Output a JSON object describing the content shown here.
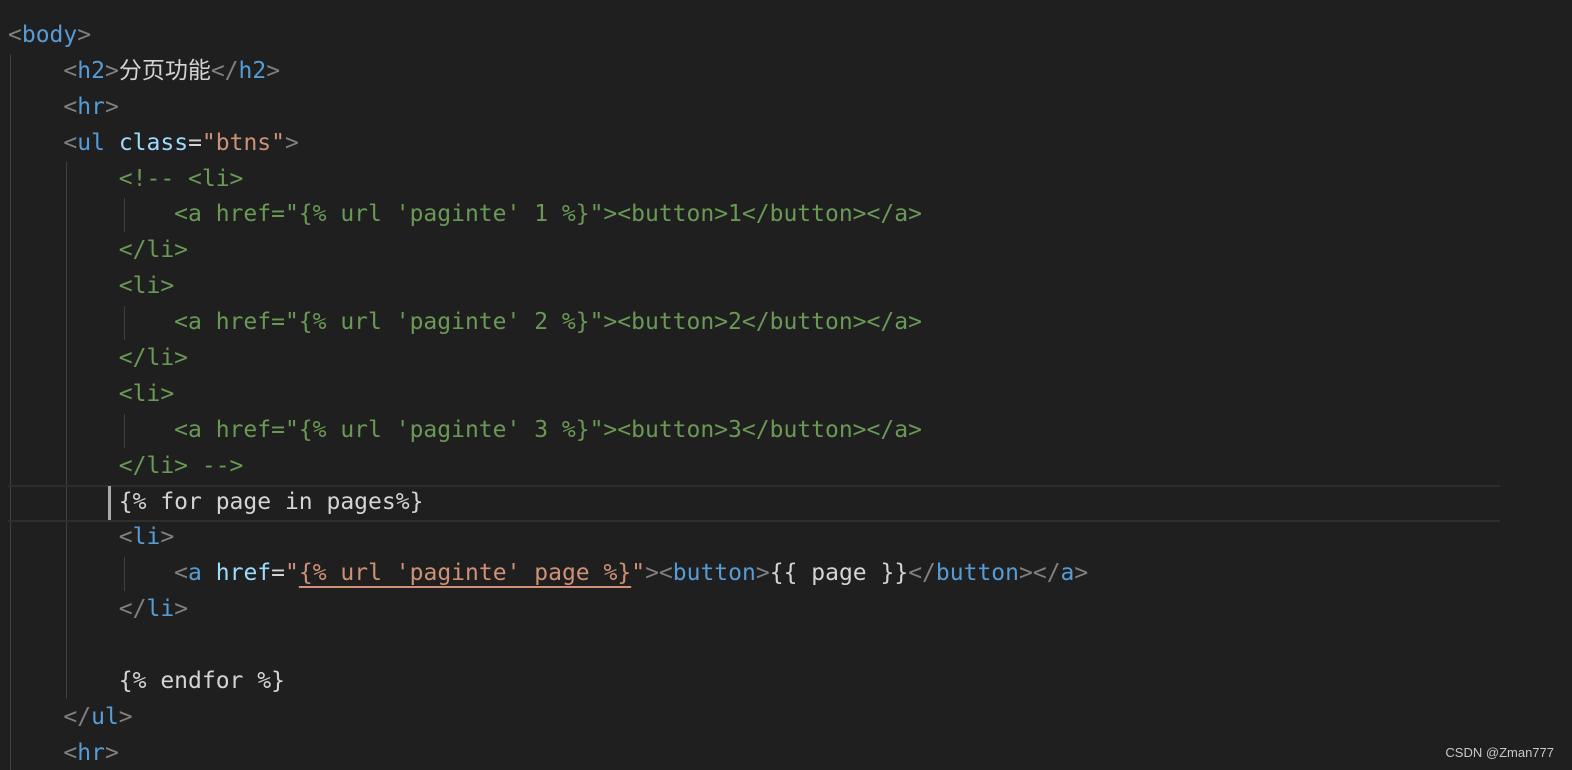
{
  "lines": [
    [
      {
        "t": "<",
        "c": "p"
      },
      {
        "t": "body",
        "c": "t"
      },
      {
        "t": ">",
        "c": "p"
      }
    ],
    [
      {
        "t": "    ",
        "c": "x"
      },
      {
        "t": "<",
        "c": "p"
      },
      {
        "t": "h2",
        "c": "t"
      },
      {
        "t": ">",
        "c": "p"
      },
      {
        "t": "分页功能",
        "c": "x"
      },
      {
        "t": "</",
        "c": "p"
      },
      {
        "t": "h2",
        "c": "t"
      },
      {
        "t": ">",
        "c": "p"
      }
    ],
    [
      {
        "t": "    ",
        "c": "x"
      },
      {
        "t": "<",
        "c": "p"
      },
      {
        "t": "hr",
        "c": "t"
      },
      {
        "t": ">",
        "c": "p"
      }
    ],
    [
      {
        "t": "    ",
        "c": "x"
      },
      {
        "t": "<",
        "c": "p"
      },
      {
        "t": "ul",
        "c": "t"
      },
      {
        "t": " ",
        "c": "x"
      },
      {
        "t": "class",
        "c": "a"
      },
      {
        "t": "=",
        "c": "x"
      },
      {
        "t": "\"btns\"",
        "c": "s"
      },
      {
        "t": ">",
        "c": "p"
      }
    ],
    [
      {
        "t": "        ",
        "c": "x"
      },
      {
        "t": "<!-- <li>",
        "c": "c"
      }
    ],
    [
      {
        "t": "            ",
        "c": "x"
      },
      {
        "t": "<a href=\"{% url 'paginte' 1 %}\"><button>1</button></a>",
        "c": "c"
      }
    ],
    [
      {
        "t": "        ",
        "c": "x"
      },
      {
        "t": "</li>",
        "c": "c"
      }
    ],
    [
      {
        "t": "        ",
        "c": "x"
      },
      {
        "t": "<li>",
        "c": "c"
      }
    ],
    [
      {
        "t": "            ",
        "c": "x"
      },
      {
        "t": "<a href=\"{% url 'paginte' 2 %}\"><button>2</button></a>",
        "c": "c"
      }
    ],
    [
      {
        "t": "        ",
        "c": "x"
      },
      {
        "t": "</li>",
        "c": "c"
      }
    ],
    [
      {
        "t": "        ",
        "c": "x"
      },
      {
        "t": "<li>",
        "c": "c"
      }
    ],
    [
      {
        "t": "            ",
        "c": "x"
      },
      {
        "t": "<a href=\"{% url 'paginte' 3 %}\"><button>3</button></a>",
        "c": "c"
      }
    ],
    [
      {
        "t": "        ",
        "c": "x"
      },
      {
        "t": "</li> -->",
        "c": "c"
      }
    ],
    [
      {
        "t": "        ",
        "c": "x"
      },
      {
        "t": "{% for page in pages%}",
        "c": "x"
      }
    ],
    [
      {
        "t": "        ",
        "c": "x"
      },
      {
        "t": "<",
        "c": "p"
      },
      {
        "t": "li",
        "c": "t"
      },
      {
        "t": ">",
        "c": "p"
      }
    ],
    [
      {
        "t": "            ",
        "c": "x"
      },
      {
        "t": "<",
        "c": "p"
      },
      {
        "t": "a",
        "c": "t"
      },
      {
        "t": " ",
        "c": "x"
      },
      {
        "t": "href",
        "c": "a"
      },
      {
        "t": "=",
        "c": "x"
      },
      {
        "t": "\"",
        "c": "s"
      },
      {
        "t": "{% url 'paginte' page %}",
        "c": "u"
      },
      {
        "t": "\"",
        "c": "s"
      },
      {
        "t": "><",
        "c": "p"
      },
      {
        "t": "button",
        "c": "t"
      },
      {
        "t": ">",
        "c": "p"
      },
      {
        "t": "{{ page }}",
        "c": "x"
      },
      {
        "t": "</",
        "c": "p"
      },
      {
        "t": "button",
        "c": "t"
      },
      {
        "t": "></",
        "c": "p"
      },
      {
        "t": "a",
        "c": "t"
      },
      {
        "t": ">",
        "c": "p"
      }
    ],
    [
      {
        "t": "        ",
        "c": "x"
      },
      {
        "t": "</",
        "c": "p"
      },
      {
        "t": "li",
        "c": "t"
      },
      {
        "t": ">",
        "c": "p"
      }
    ],
    [
      {
        "t": "",
        "c": "x"
      }
    ],
    [
      {
        "t": "        ",
        "c": "x"
      },
      {
        "t": "{% endfor %}",
        "c": "x"
      }
    ],
    [
      {
        "t": "    ",
        "c": "x"
      },
      {
        "t": "</",
        "c": "p"
      },
      {
        "t": "ul",
        "c": "t"
      },
      {
        "t": ">",
        "c": "p"
      }
    ],
    [
      {
        "t": "    ",
        "c": "x"
      },
      {
        "t": "<",
        "c": "p"
      },
      {
        "t": "hr",
        "c": "t"
      },
      {
        "t": ">",
        "c": "p"
      }
    ]
  ],
  "current_line": 13,
  "watermark": "CSDN @Zman777"
}
